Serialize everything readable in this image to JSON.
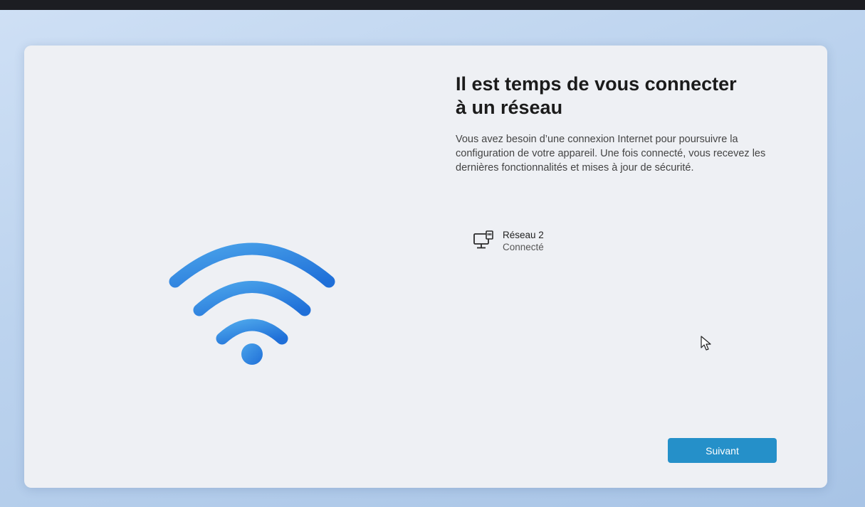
{
  "setup": {
    "title": "Il est temps de vous connecter à un réseau",
    "description": "Vous avez besoin d’une connexion Internet pour poursuivre la configuration de votre appareil. Une fois connecté, vous recevez les dernières fonctionnalités et mises à jour de sécurité.",
    "network": {
      "name": "Réseau 2",
      "status": "Connecté",
      "icon": "wired-network-icon"
    },
    "next_label": "Suivant",
    "illustration": "wifi-icon"
  },
  "colors": {
    "accent": "#2590c9",
    "wifi_light": "#4aa3ea",
    "wifi_dark": "#1f6fd8"
  }
}
